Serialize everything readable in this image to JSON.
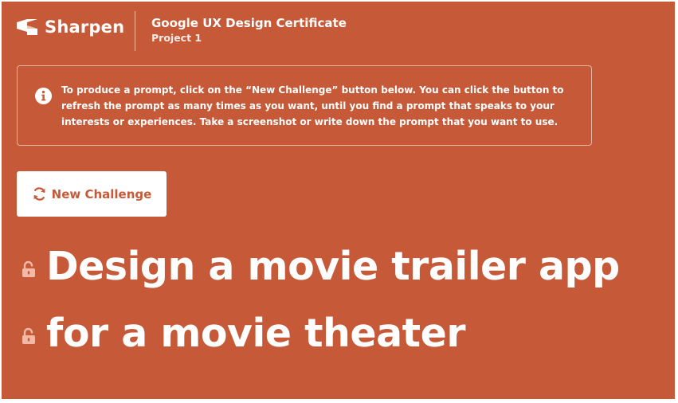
{
  "brand": {
    "name": "Sharpen",
    "logo_icon": "sharpen-logo-icon"
  },
  "course": {
    "title": "Google UX Design Certificate",
    "subtitle": "Project 1"
  },
  "notice": {
    "icon": "info-circle-icon",
    "text": "To produce a prompt, click on the “New Challenge” button below. You can click the button to refresh the prompt as many times as you want, until you find a prompt that speaks to your interests or experiences. Take a screenshot or write down the prompt that you want to use."
  },
  "actions": {
    "new_challenge_label": "New Challenge",
    "new_challenge_icon": "refresh-icon"
  },
  "prompt": {
    "lines": [
      {
        "text": "Design a movie trailer app",
        "lock_icon": "unlocked-padlock-icon",
        "locked": false
      },
      {
        "text": "for a movie theater",
        "lock_icon": "unlocked-padlock-icon",
        "locked": false
      }
    ]
  },
  "colors": {
    "background": "#c65a38",
    "text": "#ffffff",
    "button_background": "#ffffff",
    "button_text": "#c65a38",
    "lock_icon": "#f1b9a6"
  }
}
